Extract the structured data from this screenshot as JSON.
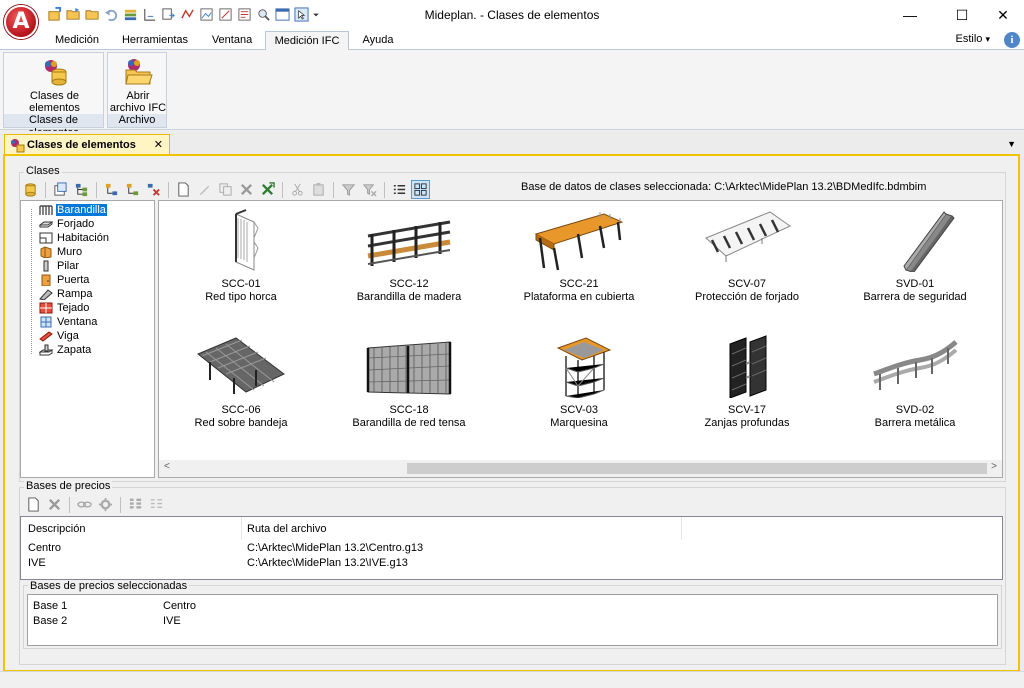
{
  "app": {
    "logo_letter": "A",
    "title": "Mideplan. - Clases de elementos",
    "accent": "#f1c400",
    "logo_color": "#c41a22"
  },
  "quick_access": [
    "new-project-icon",
    "open-folder-icon",
    "open-folder-alt-icon",
    "undo-icon",
    "layers-icon",
    "dimension-icon",
    "insert-icon",
    "polyline-icon",
    "image-icon",
    "edit-image-icon",
    "measure-icon",
    "zoom-icon",
    "window-icon",
    "cursor-icon",
    "more-icon"
  ],
  "window_controls": {
    "minimize": "—",
    "maximize": "☐",
    "close": "✕"
  },
  "ribbon": {
    "tabs": [
      "Medición",
      "Herramientas",
      "Ventana",
      "Medición IFC",
      "Ayuda"
    ],
    "active_tab": "Medición IFC",
    "style_menu": "Estilo",
    "style_chevron": "▾",
    "info_symbol": "i",
    "groups": [
      {
        "label": "Clases de elementos",
        "buttons": [
          {
            "label_line1": "Clases de",
            "label_line2": "elementos"
          }
        ]
      },
      {
        "label": "Archivo",
        "buttons": [
          {
            "label_line1": "Abrir",
            "label_line2": "archivo IFC"
          }
        ]
      }
    ]
  },
  "document_tab": {
    "label": "Clases de elementos",
    "close": "✕",
    "dropdown": "▼"
  },
  "clases": {
    "group_title": "Clases",
    "db_label": "Base de datos de clases seleccionada: C:\\Arktec\\MidePlan 13.2\\BDMedIfc.bdmbim",
    "tree": [
      {
        "label": "Barandilla",
        "icon": "railing-icon",
        "selected": true
      },
      {
        "label": "Forjado",
        "icon": "slab-icon"
      },
      {
        "label": "Habitación",
        "icon": "room-icon"
      },
      {
        "label": "Muro",
        "icon": "wall-icon"
      },
      {
        "label": "Pilar",
        "icon": "column-icon"
      },
      {
        "label": "Puerta",
        "icon": "door-icon"
      },
      {
        "label": "Rampa",
        "icon": "ramp-icon"
      },
      {
        "label": "Tejado",
        "icon": "roof-icon"
      },
      {
        "label": "Ventana",
        "icon": "window-icon"
      },
      {
        "label": "Viga",
        "icon": "beam-icon"
      },
      {
        "label": "Zapata",
        "icon": "footing-icon"
      }
    ],
    "gallery": [
      {
        "code": "SCC-01",
        "name": "Red tipo horca",
        "icon": "net-horca-icon"
      },
      {
        "code": "SCC-12",
        "name": "Barandilla de madera",
        "icon": "wood-railing-icon"
      },
      {
        "code": "SCC-21",
        "name": "Plataforma en cubierta",
        "icon": "roof-platform-icon"
      },
      {
        "code": "SCV-07",
        "name": "Protección de forjado",
        "icon": "slab-protection-icon"
      },
      {
        "code": "SVD-01",
        "name": "Barrera de seguridad",
        "icon": "safety-barrier-icon"
      },
      {
        "code": "SCC-06",
        "name": "Red sobre bandeja",
        "icon": "net-tray-icon"
      },
      {
        "code": "SCC-18",
        "name": "Barandilla de red tensa",
        "icon": "net-railing-icon"
      },
      {
        "code": "SCV-03",
        "name": "Marquesina",
        "icon": "canopy-icon"
      },
      {
        "code": "SCV-17",
        "name": "Zanjas profundas",
        "icon": "trench-icon"
      },
      {
        "code": "SVD-02",
        "name": "Barrera metálica",
        "icon": "metal-barrier-icon"
      }
    ]
  },
  "precios": {
    "group_title": "Bases de precios",
    "columns": [
      "Descripción",
      "Ruta del archivo"
    ],
    "rows": [
      {
        "desc": "Centro",
        "path": "C:\\Arktec\\MidePlan 13.2\\Centro.g13"
      },
      {
        "desc": "IVE",
        "path": "C:\\Arktec\\MidePlan 13.2\\IVE.g13"
      }
    ],
    "selected_title": "Bases de precios seleccionadas",
    "selected_rows": [
      {
        "name": "Base 1",
        "value": "Centro"
      },
      {
        "name": "Base 2",
        "value": "IVE"
      }
    ]
  },
  "scroll": {
    "left": "<",
    "right": ">"
  }
}
